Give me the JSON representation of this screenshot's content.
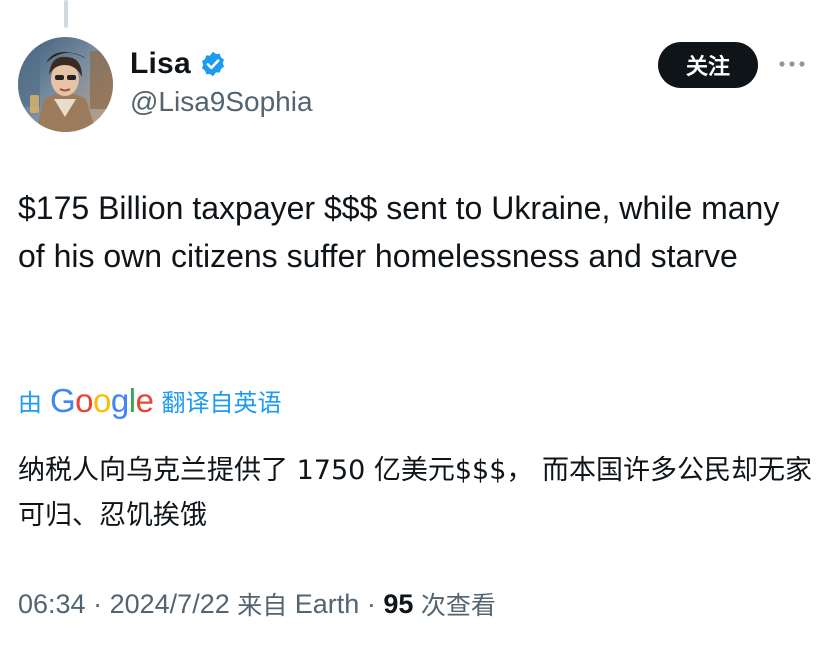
{
  "author": {
    "name": "Lisa",
    "handle": "@Lisa9Sophia"
  },
  "follow_button_label": "关注",
  "tweet": {
    "text": "$175 Billion taxpayer $$$ sent to Ukraine, while many of his own citizens suffer homelessness and starve"
  },
  "translation": {
    "prefix": "由",
    "provider_letters": [
      "G",
      "o",
      "o",
      "g",
      "l",
      "e"
    ],
    "suffix": "翻译自英语",
    "text": "纳税人向乌克兰提供了 1750 亿美元$$$， 而本国许多公民却无家可归、忍饥挨饿"
  },
  "meta": {
    "time": "06:34",
    "separator": "·",
    "date": "2024/7/22",
    "source_prefix": "来自",
    "source": "Earth",
    "view_count": "95",
    "view_label": "次查看"
  },
  "colors": {
    "accent_blue": "#1d9bf0",
    "verified_blue": "#1d9bf0",
    "secondary_text": "#536471",
    "google_blue": "#4285F4",
    "google_red": "#EA4335",
    "google_yellow": "#FBBC05",
    "google_green": "#34A853"
  },
  "icons": {
    "verified": "verified-badge-icon",
    "more": "more-options-icon",
    "avatar": "avatar-image"
  }
}
